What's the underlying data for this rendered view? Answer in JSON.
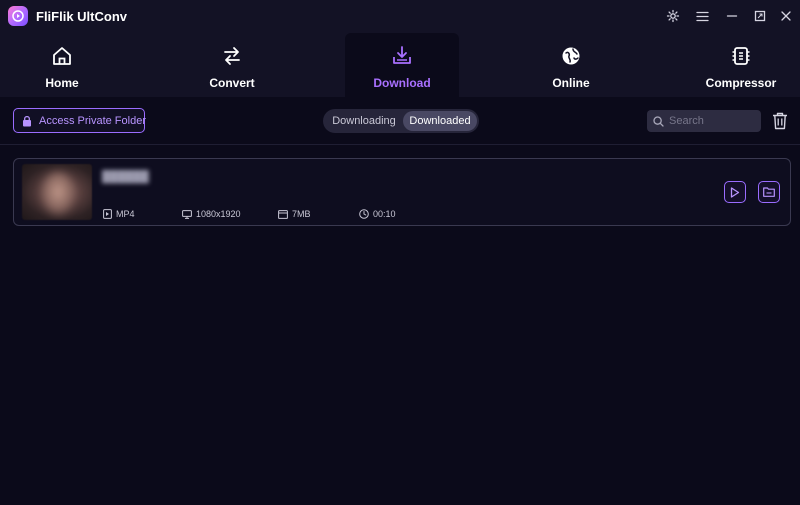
{
  "app": {
    "title": "FliFlik UltConv"
  },
  "nav": {
    "items": [
      {
        "label": "Home",
        "icon": "home-icon"
      },
      {
        "label": "Convert",
        "icon": "convert-icon"
      },
      {
        "label": "Download",
        "icon": "download-icon",
        "active": true
      },
      {
        "label": "Online",
        "icon": "globe-icon"
      },
      {
        "label": "Compressor",
        "icon": "compressor-icon"
      }
    ]
  },
  "toolbar": {
    "private_folder_label": "Access Private Folder",
    "tabs": [
      {
        "label": "Downloading",
        "active": false
      },
      {
        "label": "Downloaded",
        "active": true
      }
    ],
    "search_placeholder": "Search"
  },
  "downloads": [
    {
      "format": "MP4",
      "resolution": "1080x1920",
      "size": "7MB",
      "duration": "00:10"
    }
  ],
  "colors": {
    "accent": "#a970ff",
    "background": "#0b0a1a",
    "header": "#131225"
  }
}
